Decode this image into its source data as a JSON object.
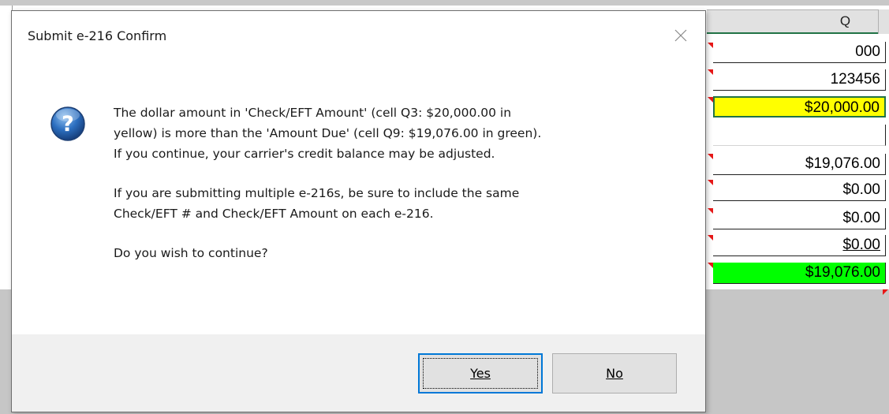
{
  "spreadsheet": {
    "column_header": "Q",
    "cells": [
      {
        "value": "000",
        "style": "plain"
      },
      {
        "value": "123456",
        "style": "plain"
      },
      {
        "value": "$20,000.00",
        "style": "yellow"
      },
      {
        "value": "",
        "style": "plain"
      },
      {
        "value": "$19,076.00",
        "style": "plain"
      },
      {
        "value": "$0.00",
        "style": "plain"
      },
      {
        "value": "$0.00",
        "style": "plain"
      },
      {
        "value": "$0.00",
        "style": "underline"
      },
      {
        "value": "$19,076.00",
        "style": "green"
      }
    ],
    "colors": {
      "highlight_yellow": "#ffff00",
      "highlight_green": "#00ff00",
      "comment_marker": "#e81818"
    }
  },
  "dialog": {
    "title": "Submit e-216 Confirm",
    "close_icon": "close-icon",
    "icon": "question-icon",
    "message": {
      "paragraph1_line1": "The dollar amount in 'Check/EFT Amount' (cell Q3: $20,000.00 in",
      "paragraph1_line2": "yellow) is more than the 'Amount Due' (cell Q9: $19,076.00 in green).",
      "paragraph1_line3": "If you continue, your carrier's credit balance may be adjusted.",
      "paragraph2_line1": "If you are submitting multiple e-216s, be sure to include the same",
      "paragraph2_line2": "Check/EFT # and Check/EFT Amount on each e-216.",
      "paragraph3": "Do you wish to continue?"
    },
    "buttons": {
      "yes_label": "Yes",
      "no_label": "No"
    }
  }
}
